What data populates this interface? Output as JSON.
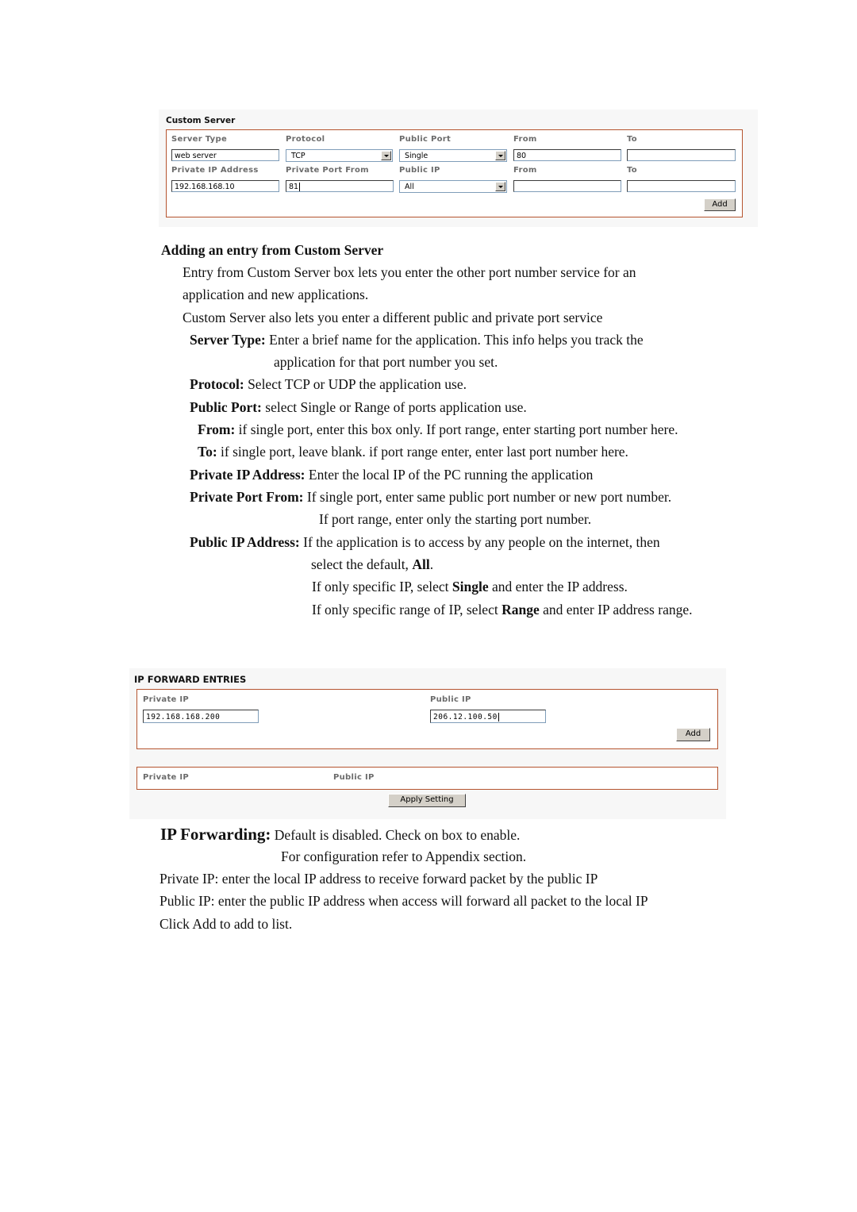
{
  "custom_server": {
    "title": "Custom Server",
    "row1_labels": [
      "Server Type",
      "Protocol",
      "Public Port",
      "From",
      "To"
    ],
    "row2_labels": [
      "Private IP Address",
      "Private Port From",
      "Public IP",
      "From",
      "To"
    ],
    "server_type_value": "web server",
    "protocol_value": "TCP",
    "public_port_value": "Single",
    "public_from_value": "80",
    "public_to_value": "",
    "private_ip_value": "192.168.168.10",
    "private_port_from_value": "81",
    "public_ip_value": "All",
    "public_ip_from_value": "",
    "public_ip_to_value": "",
    "add_label": "Add"
  },
  "custom_server_doc": {
    "heading": "Adding an entry from Custom Server",
    "p1_line1": "Entry from Custom Server box lets you enter the other port number service for an",
    "p1_line2": "application and new applications.",
    "p2": "Custom Server also lets you enter a different public and private port service",
    "server_type_term": "Server Type:",
    "server_type_desc1": " Enter a brief name for the application. This info helps you track the",
    "server_type_desc2": "application for that port number you set.",
    "protocol_term": "Protocol:",
    "protocol_desc": " Select TCP or UDP the application use.",
    "public_port_term": "Public Port:",
    "public_port_desc": " select Single or Range of ports application use.",
    "from_term": "From:",
    "from_desc": " if single port, enter this box only. If port range, enter starting port number here.",
    "to_term": "To:",
    "to_desc": " if single port, leave blank. if port range enter, enter last port number here.",
    "private_ip_term": "Private IP Address:",
    "private_ip_desc": " Enter the local IP of the PC running the application",
    "private_port_term": "Private Port From:",
    "private_port_desc1": " If single port, enter same public port number or new port number.",
    "private_port_desc2": "If port range, enter only the starting port number.",
    "public_ip_term": "Public IP Address:",
    "public_ip_desc1": " If the application is to access by any people on the internet, then",
    "public_ip_desc2_pre": "select the default, ",
    "public_ip_desc2_bold": "All",
    "public_ip_desc2_post": ".",
    "public_ip_desc3_pre": "If only specific IP, select ",
    "public_ip_desc3_bold": "Single",
    "public_ip_desc3_post": " and enter the IP address.",
    "public_ip_desc4_pre": "If only specific range of IP, select ",
    "public_ip_desc4_bold": "Range",
    "public_ip_desc4_post": " and enter IP address range."
  },
  "ip_forward": {
    "title": "IP FORWARD ENTRIES",
    "private_ip_label": "Private IP",
    "public_ip_label": "Public IP",
    "private_ip_value": "192.168.168.200",
    "public_ip_value": "206.12.100.50",
    "add_label": "Add",
    "list_headers": [
      "Private IP",
      "Public IP"
    ],
    "apply_label": "Apply Setting"
  },
  "ip_forward_doc": {
    "term": "IP Forwarding:",
    "desc1": " Default is disabled. Check on box to enable.",
    "desc2": "For configuration refer to Appendix section.",
    "line3": "Private IP: enter the local IP address to receive forward packet by the public IP",
    "line4": "Public IP: enter the public IP address when access will forward all packet to the local IP",
    "line5": "Click Add to add to list."
  }
}
